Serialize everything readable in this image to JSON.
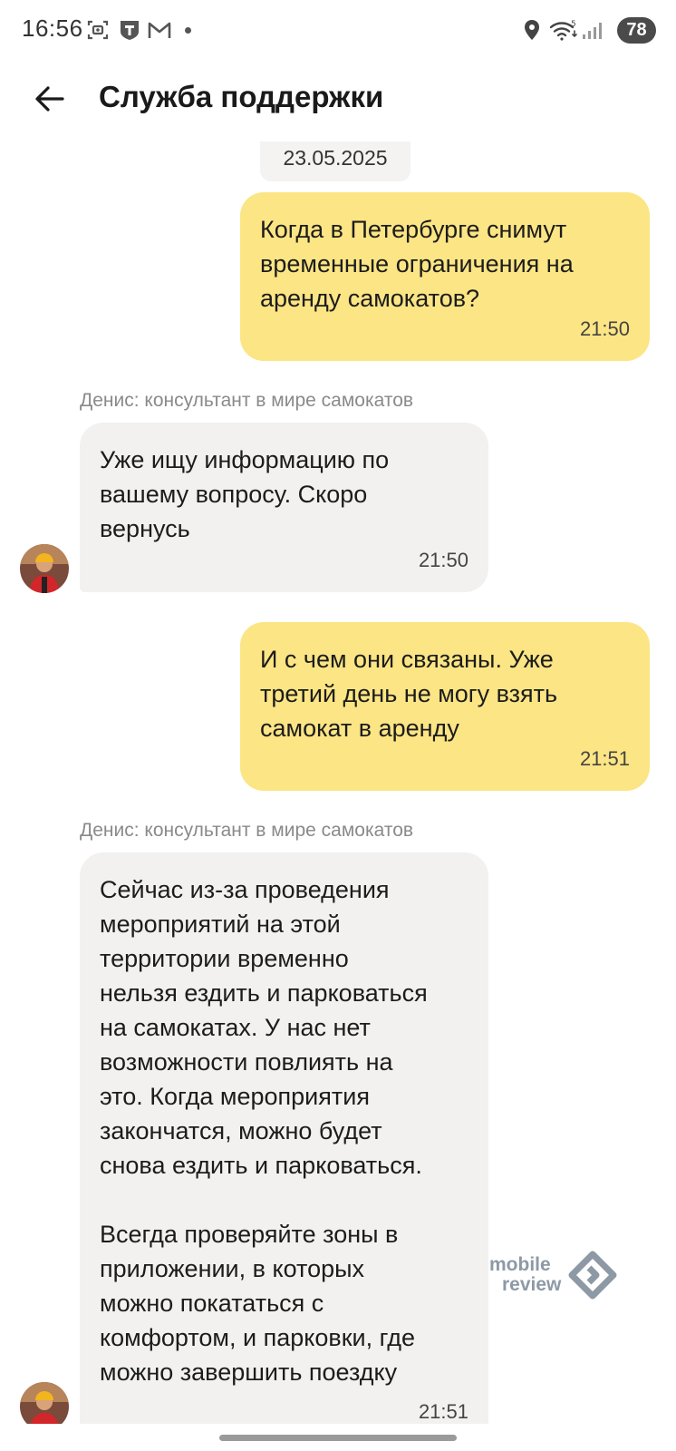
{
  "status_bar": {
    "time": "16:56",
    "battery": "78",
    "icons": [
      "screenshot-icon",
      "tinkoff-icon",
      "gmail-icon",
      "notification-dot",
      "location-icon",
      "wifi-icon",
      "signal-icon"
    ]
  },
  "header": {
    "title": "Служба поддержки",
    "back_icon": "arrow-left-icon"
  },
  "chat": {
    "date": "23.05.2025",
    "messages": [
      {
        "direction": "out",
        "text": "Когда в Петербурге снимут\nвременные ограничения на\nаренду самокатов?",
        "time": "21:50"
      },
      {
        "direction": "in",
        "sender": "Денис: консультант в мире самокатов",
        "text": "Уже ищу информацию по\nвашему вопросу. Скоро\nвернусь",
        "time": "21:50"
      },
      {
        "direction": "out",
        "text": "И с чем они связаны. Уже\nтретий день не могу взять\nсамокат в аренду",
        "time": "21:51"
      },
      {
        "direction": "in",
        "sender": "Денис: консультант в мире самокатов",
        "text": "Сейчас из-за проведения\nмероприятий на этой\nтерритории временно\nнельзя ездить и парковаться\nна самокатах. У нас нет\nвозможности повлиять на\nэто. Когда мероприятия\nзакончатся, можно будет\nснова ездить и парковаться.\n\nВсегда проверяйте зоны в\nприложении, в которых\nможно покататься с\nкомфортом, и парковки, где\nможно завершить поездку",
        "time": "21:51"
      }
    ]
  },
  "watermark": {
    "line1": "mobile",
    "line2": "review"
  },
  "colors": {
    "outgoing_bubble": "#fce584",
    "incoming_bubble": "#f2f1ef",
    "date_chip": "#f4f3f1",
    "sender_text": "#8a8a8a"
  }
}
